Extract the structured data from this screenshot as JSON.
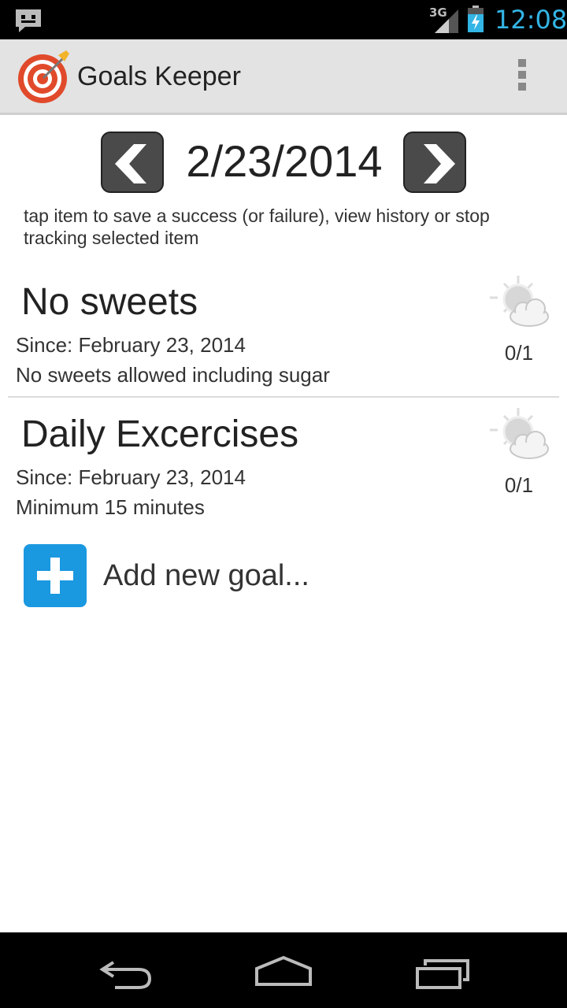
{
  "status_bar": {
    "network": "3G",
    "time": "12:08",
    "notification_icon": "message-icon"
  },
  "action_bar": {
    "title": "Goals Keeper",
    "logo_icon": "target-icon",
    "overflow_icon": "overflow-menu-icon"
  },
  "date_nav": {
    "date": "2/23/2014",
    "prev_icon": "chevron-left-icon",
    "next_icon": "chevron-right-icon"
  },
  "hint": "tap item to save a success (or failure), view history or stop tracking selected item",
  "goals": [
    {
      "title": "No sweets",
      "since": "Since: February 23, 2014",
      "description": "No sweets allowed including sugar",
      "score": "0/1",
      "weather_icon": "partly-cloudy-icon"
    },
    {
      "title": "Daily Excercises",
      "since": "Since: February 23, 2014",
      "description": "Minimum 15 minutes",
      "score": "0/1",
      "weather_icon": "partly-cloudy-icon"
    }
  ],
  "add_goal": {
    "label": "Add new goal...",
    "icon": "plus-icon"
  },
  "nav_bar": {
    "back_icon": "back-icon",
    "home_icon": "home-icon",
    "recents_icon": "recent-apps-icon"
  },
  "colors": {
    "accent": "#33b5e5",
    "add_button": "#1a98e0",
    "action_bar": "#e3e3e3"
  }
}
